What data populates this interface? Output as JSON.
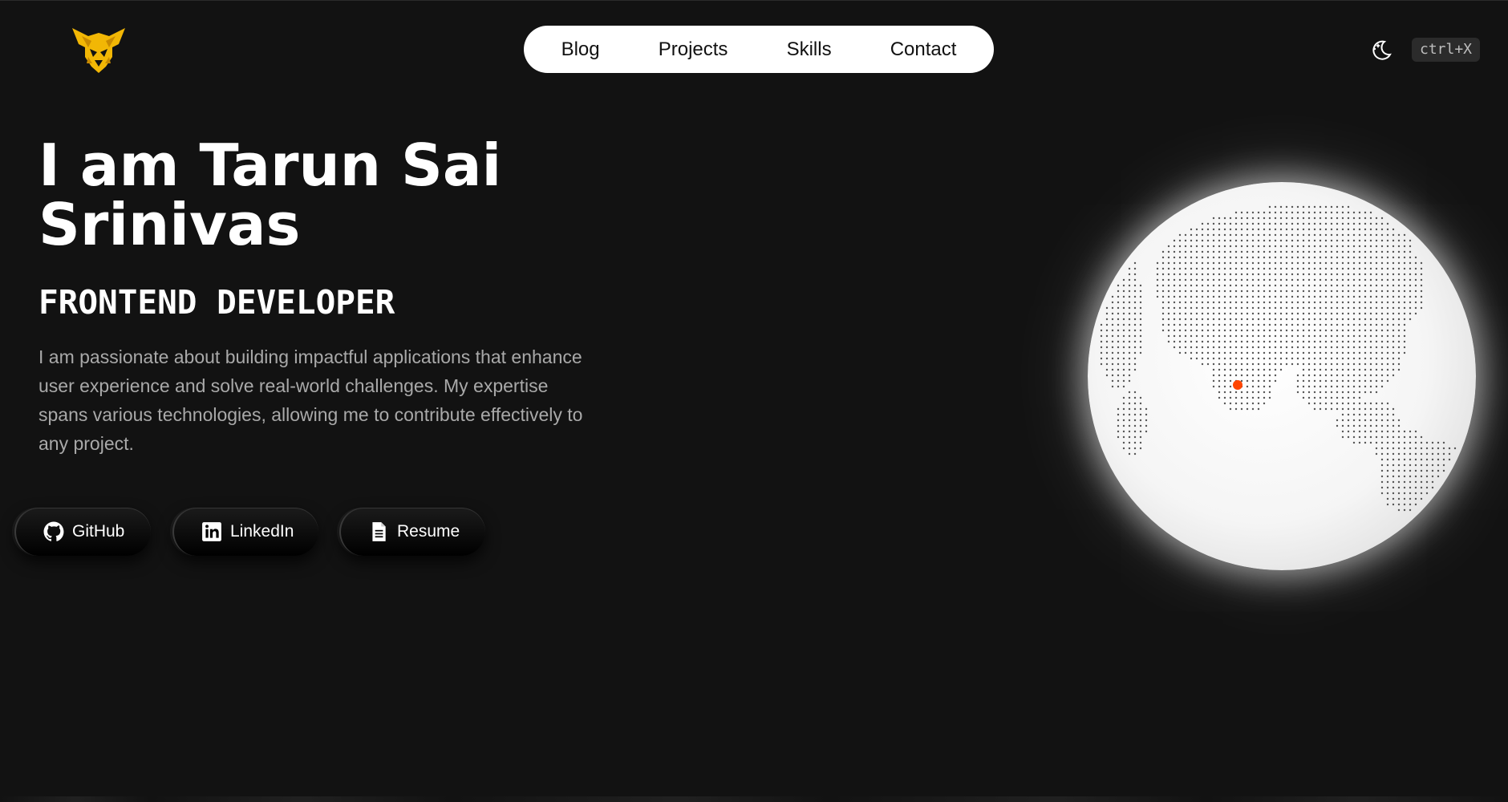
{
  "header": {
    "nav": [
      {
        "label": "Blog"
      },
      {
        "label": "Projects"
      },
      {
        "label": "Skills"
      },
      {
        "label": "Contact"
      }
    ],
    "theme_icon": "moon-stars-icon",
    "shortcut": "ctrl+X"
  },
  "hero": {
    "title": "I am Tarun Sai Srinivas",
    "subtitle": "FRONTEND DEVELOPER",
    "description": "I am passionate about building impactful applications that enhance user experience and solve real-world challenges. My expertise spans various technologies, allowing me to contribute effectively to any project."
  },
  "social": [
    {
      "label": "GitHub",
      "icon": "github-icon"
    },
    {
      "label": "LinkedIn",
      "icon": "linkedin-icon"
    },
    {
      "label": "Resume",
      "icon": "document-icon"
    }
  ],
  "colors": {
    "background": "#121212",
    "logo": "#f2b705",
    "marker": "#ff4500"
  }
}
